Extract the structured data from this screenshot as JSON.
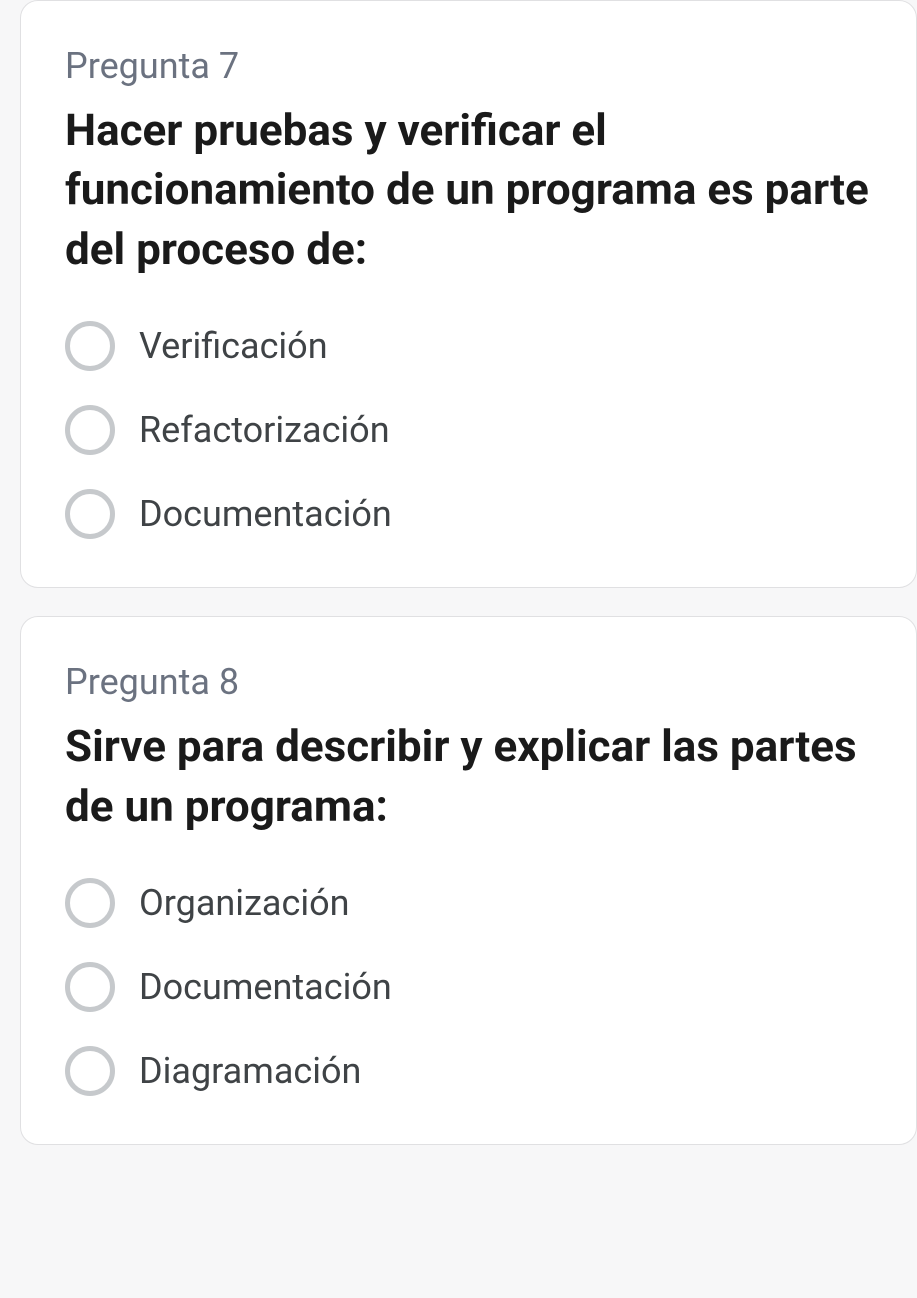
{
  "questions": [
    {
      "number": "Pregunta 7",
      "text": "Hacer pruebas y verificar el funcionamiento de un programa es parte del proceso de:",
      "options": [
        "Verificación",
        "Refactorización",
        "Documentación"
      ]
    },
    {
      "number": "Pregunta 8",
      "text": "Sirve para describir y explicar las partes de un programa:",
      "options": [
        "Organización",
        "Documentación",
        "Diagramación"
      ]
    }
  ]
}
